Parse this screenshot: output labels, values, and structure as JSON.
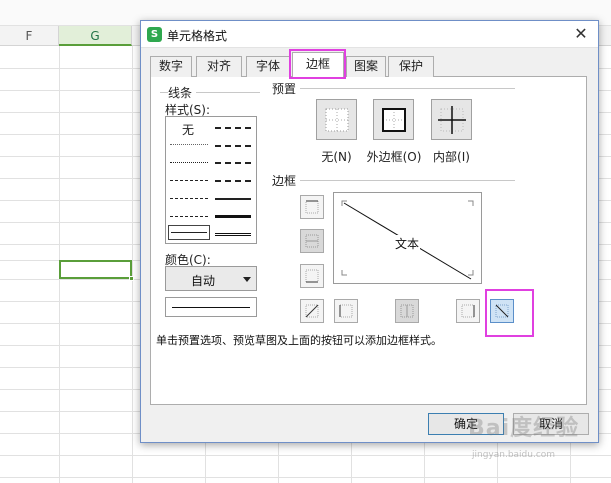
{
  "sheet": {
    "columns": [
      "F",
      "G"
    ],
    "selected_column": "G"
  },
  "dialog": {
    "title": "单元格格式",
    "tabs": [
      "数字",
      "对齐",
      "字体",
      "边框",
      "图案",
      "保护"
    ],
    "active_tab": "边框",
    "line_group": {
      "title": "线条",
      "style_label": "样式(S):",
      "none_label": "无",
      "color_label": "颜色(C):",
      "color_value": "自动"
    },
    "preset_group": {
      "title": "预置",
      "items": [
        {
          "label": "无(N)",
          "icon": "no-border-icon"
        },
        {
          "label": "外边框(O)",
          "icon": "outer-border-icon"
        },
        {
          "label": "内部(I)",
          "icon": "inner-border-icon"
        }
      ]
    },
    "border_group": {
      "title": "边框",
      "preview_text": "文本",
      "buttons": [
        "top-border-icon",
        "middle-horizontal-border-icon",
        "bottom-border-icon",
        "diagonal-up-border-icon",
        "left-border-icon",
        "middle-vertical-border-icon",
        "right-border-icon",
        "diagonal-down-border-icon"
      ]
    },
    "hint": "单击预置选项、预览草图及上面的按钮可以添加边框样式。",
    "ok_label": "确定",
    "cancel_label": "取消"
  },
  "watermark": {
    "text": "Bai度经验",
    "sub": "jingyan.baidu.com"
  },
  "colors": {
    "highlight": "#e040e0",
    "selection_green": "#5a9e3a",
    "dialog_border": "#6f8fc7",
    "app_icon": "#2fa84f"
  }
}
